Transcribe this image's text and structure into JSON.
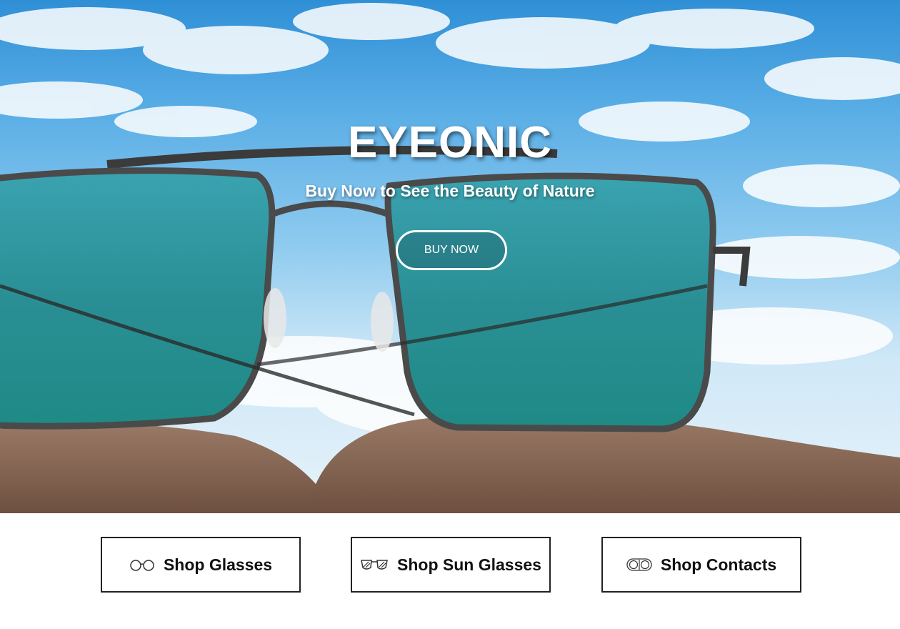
{
  "hero": {
    "title": "EYEONIC",
    "subtitle": "Buy Now to See the Beauty of Nature",
    "cta_label": "BUY NOW",
    "background_image": "sunglasses-on-rocks-sky"
  },
  "shop": {
    "items": [
      {
        "label": "Shop Glasses",
        "icon": "glasses-icon"
      },
      {
        "label": "Shop Sun Glasses",
        "icon": "sunglasses-icon"
      },
      {
        "label": "Shop Contacts",
        "icon": "contact-lens-icon"
      }
    ]
  },
  "colors": {
    "sky": "#5aaee6",
    "lens": "#2e9a9c",
    "frame": "#4a4a4a",
    "rock": "#8a6a58",
    "text": "#ffffff",
    "button_border": "#222222"
  }
}
